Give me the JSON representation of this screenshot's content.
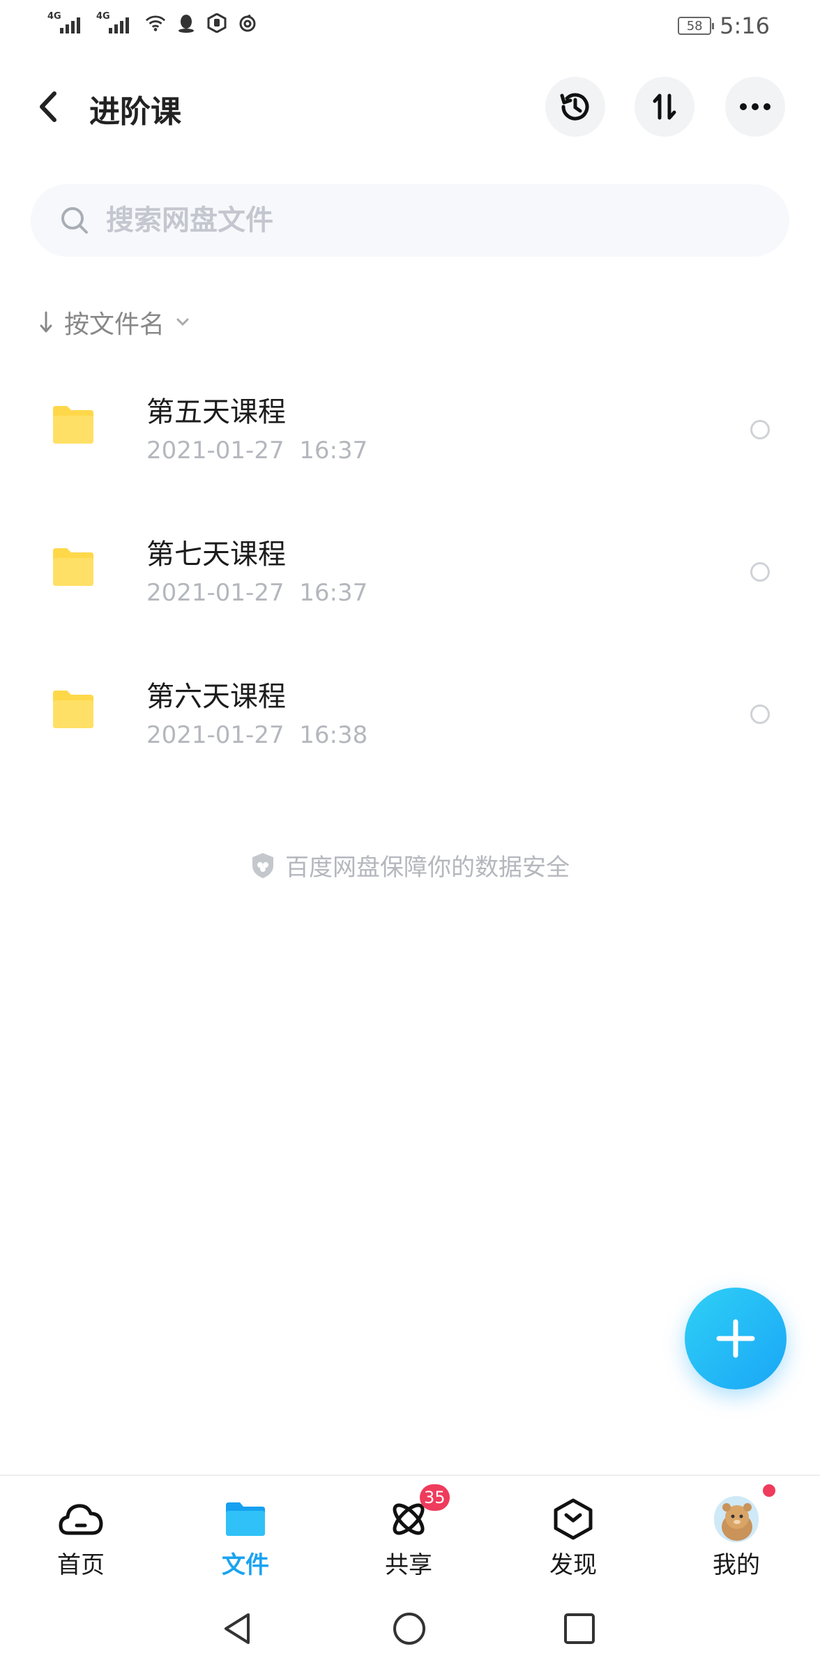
{
  "status_bar": {
    "network_1": "4G",
    "network_2": "4G",
    "battery": "58",
    "time": "5:16"
  },
  "header": {
    "title": "进阶课"
  },
  "search": {
    "placeholder": "搜索网盘文件"
  },
  "sort": {
    "label": "按文件名"
  },
  "files": [
    {
      "name": "第五天课程",
      "date": "2021-01-27",
      "time": "16:37"
    },
    {
      "name": "第七天课程",
      "date": "2021-01-27",
      "time": "16:37"
    },
    {
      "name": "第六天课程",
      "date": "2021-01-27",
      "time": "16:38"
    }
  ],
  "safety_note": "百度网盘保障你的数据安全",
  "tabs": [
    {
      "label": "首页",
      "icon": "cloud-icon"
    },
    {
      "label": "文件",
      "icon": "folder-icon",
      "active": true
    },
    {
      "label": "共享",
      "icon": "share-icon",
      "badge": "35"
    },
    {
      "label": "发现",
      "icon": "discover-icon"
    },
    {
      "label": "我的",
      "icon": "avatar-icon"
    }
  ],
  "colors": {
    "accent": "#1ba3f0",
    "folder": "#ffd84a",
    "badge": "#ef3b5c"
  }
}
